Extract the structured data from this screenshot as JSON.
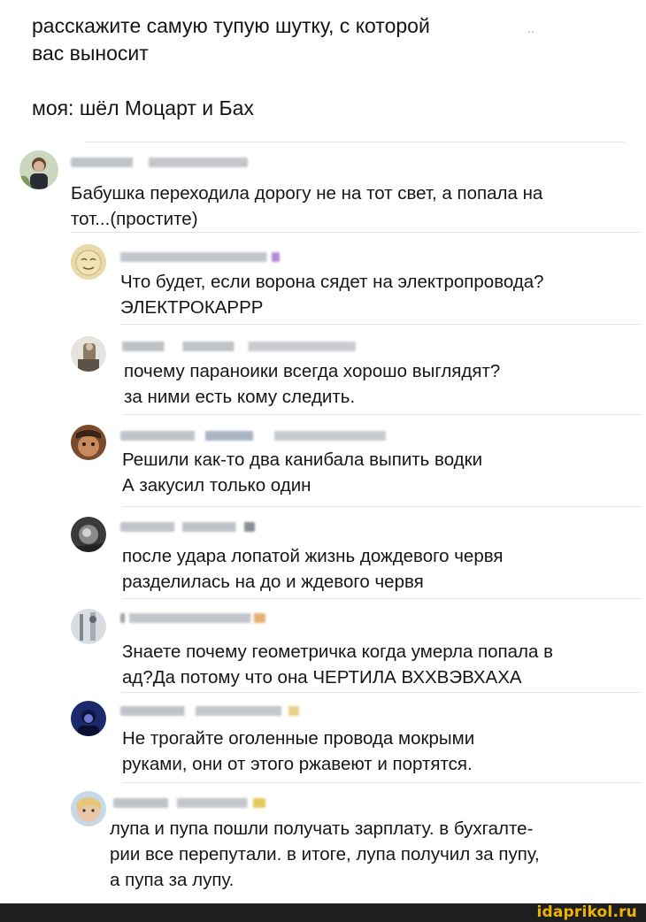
{
  "post": {
    "text": "расскажите самую тупую шутку, с которой\nвас выносит\n\nмоя: шёл Моцарт и Бах",
    "dots": "..",
    "comments": [
      {
        "text": "Бабушка переходила дорогу не на тот свет, а попала на\nтот...(простите)"
      },
      {
        "text": "Что будет, если ворона сядет на электропровода?\nЭЛЕКТРОКАРРР"
      },
      {
        "text": "почему параноики всегда хорошо выглядят?\nза ними есть кому следить."
      },
      {
        "text": "Решили как-то два канибала выпить водки\nА закусил только один"
      },
      {
        "text": "после удара лопатой жизнь дождевого червя\nразделилась на до и ждевого червя"
      },
      {
        "text": "Знаете почему геометричка когда умерла попала в\nад?Да потому что она ЧЕРТИЛА ВХХВЭВХАХА"
      },
      {
        "text": "Не трогайте оголенные провода мокрыми\nруками, они от этого ржавеют и портятся."
      },
      {
        "text": "лупа и пупа пошли получать зарплату. в бухгалте-\nрии все перепутали. в итоге, лупа получил за пупу,\nа пупа за лупу."
      }
    ]
  },
  "watermark": "idaprikol.ru",
  "colors": {
    "footer": "#1e1e1e",
    "brand": "#f0b400",
    "separator": "#e4e4e4"
  }
}
